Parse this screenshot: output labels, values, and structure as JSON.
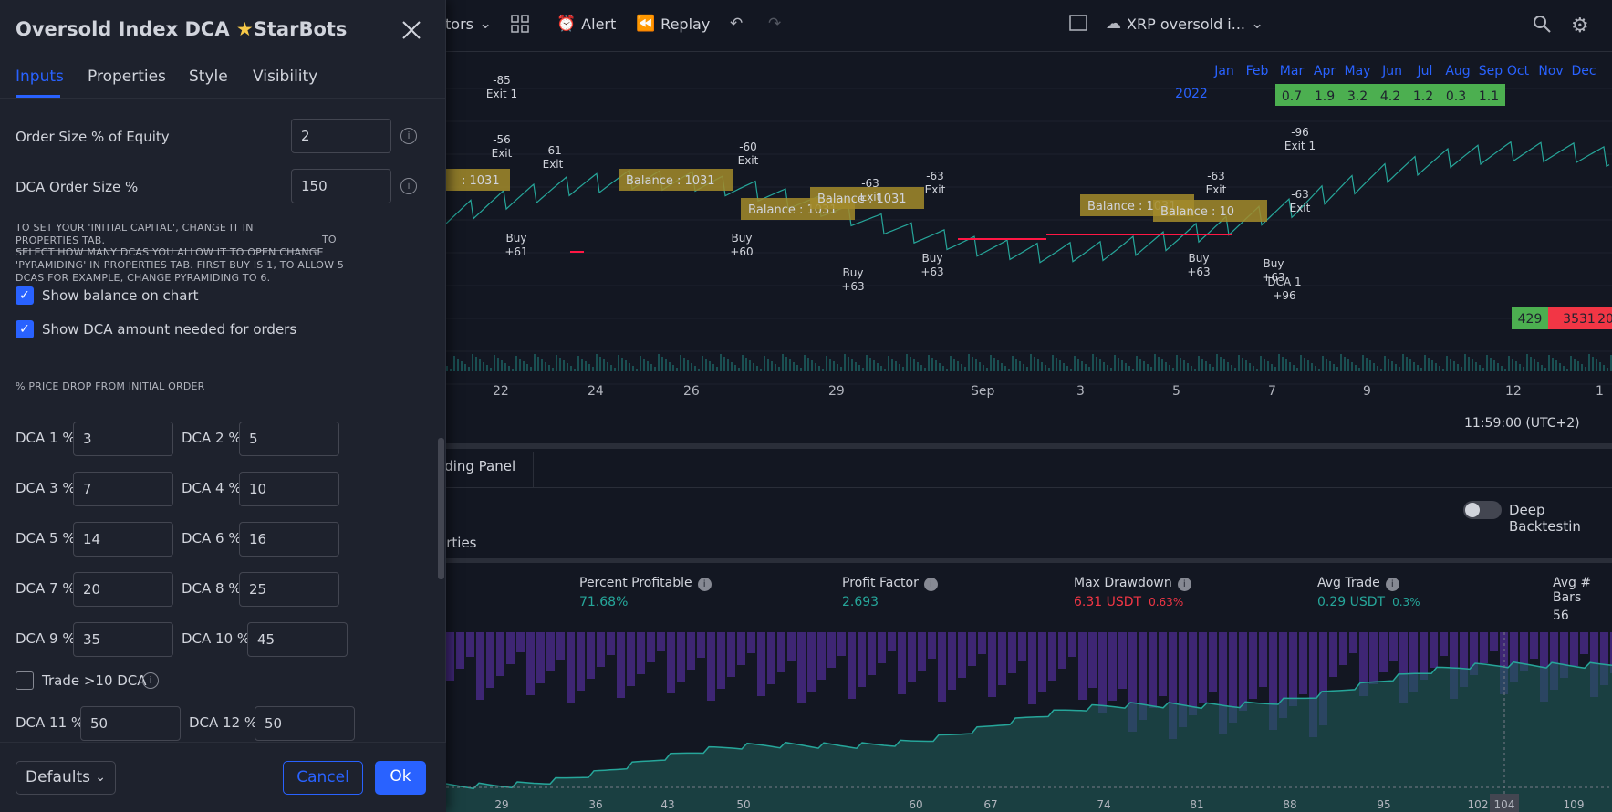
{
  "toolbar": {
    "indicators_partial": "tors",
    "alert": "Alert",
    "replay": "Replay",
    "layout_name": "XRP oversold i..."
  },
  "chart": {
    "x_ticks": [
      "22",
      "24",
      "26",
      "29",
      "Sep",
      "3",
      "5",
      "7",
      "9",
      "12",
      "1"
    ],
    "timestamp": "11:59:00 (UTC+2)",
    "trading_panel": "ading Panel",
    "properties_partial": "erties",
    "deep_backtesting": "Deep Backtestin",
    "months": [
      "Jan",
      "Feb",
      "Mar",
      "Apr",
      "May",
      "Jun",
      "Jul",
      "Aug",
      "Sep",
      "Oct",
      "Nov",
      "Dec"
    ],
    "year": "2022",
    "monthly_returns": [
      "0.7",
      "1.9",
      "3.2",
      "4.2",
      "1.2",
      "0.3",
      "1.1"
    ],
    "summary": [
      "429",
      "3531",
      "20"
    ],
    "labels": [
      {
        "text": "-85\nExit 1"
      },
      {
        "text": "-56\nExit"
      },
      {
        "text": "-61\nExit"
      },
      {
        "text": "-60\nExit"
      },
      {
        "text": "-63\nExit"
      },
      {
        "text": "-63\nExit"
      },
      {
        "text": "-63\nExit"
      },
      {
        "text": "-96\nExit 1"
      },
      {
        "text": "-63\nExit"
      },
      {
        "text": "Buy\n+61"
      },
      {
        "text": "Buy\n+60"
      },
      {
        "text": "Buy\n+63"
      },
      {
        "text": "Buy\n+63"
      },
      {
        "text": "Buy\n+63"
      },
      {
        "text": "Buy\n+63"
      },
      {
        "text": "DCA 1\n+96"
      }
    ],
    "balances": [
      "Balance  : 1031",
      "Balance  : 1031",
      "Balance  : 1031",
      "Balance  : 1031",
      "Balance  : 10",
      "Balance  : 1031"
    ],
    "bal_left": ": 1031"
  },
  "stats": [
    {
      "label": "Percent Profitable",
      "value": "71.68%",
      "sub": "",
      "color": "#26a69a"
    },
    {
      "label": "Profit Factor",
      "value": "2.693",
      "sub": "",
      "color": "#26a69a"
    },
    {
      "label": "Max Drawdown",
      "value": "6.31 USDT",
      "sub": "0.63%",
      "color": "#f23645"
    },
    {
      "label": "Avg Trade",
      "value": "0.29 USDT",
      "sub": "0.3%",
      "color": "#26a69a"
    },
    {
      "label": "Avg # Bars",
      "value": "56",
      "sub": "",
      "color": "#d1d4dc"
    }
  ],
  "equity_x_ticks": [
    "29",
    "36",
    "43",
    "50",
    "60",
    "67",
    "74",
    "81",
    "88",
    "95",
    "102",
    "104",
    "109"
  ],
  "dialog": {
    "title": "Oversold Index DCA",
    "brand": "StarBots",
    "tabs": [
      "Inputs",
      "Properties",
      "Style",
      "Visibility"
    ],
    "order_size_label": "Order Size % of Equity",
    "order_size_value": "2",
    "dca_order_label": "DCA Order Size %",
    "dca_order_value": "150",
    "note1": "TO SET YOUR 'INITIAL CAPITAL', CHANGE IT IN PROPERTIES TAB.",
    "note2a": "SELECT HOW MANY DCAS YOU ALLOW IT TO OPEN CHANGE",
    "note2b": "'PYRAMIDING' IN PROPERTIES TAB. FIRST BUY IS 1, TO ALLOW 5",
    "note2c": "DCAS FOR EXAMPLE, CHANGE PYRAMIDING TO 6.",
    "note2_to": "TO",
    "show_balance": "Show balance on chart",
    "show_dca": "Show DCA amount needed for orders",
    "price_drop": "% PRICE DROP FROM INITIAL ORDER",
    "dca": [
      {
        "label": "DCA 1 %",
        "value": "3"
      },
      {
        "label": "DCA 2 %",
        "value": "5"
      },
      {
        "label": "DCA 3 %",
        "value": "7"
      },
      {
        "label": "DCA 4 %",
        "value": "10"
      },
      {
        "label": "DCA 5 %",
        "value": "14"
      },
      {
        "label": "DCA 6 %",
        "value": "16"
      },
      {
        "label": "DCA 7 %",
        "value": "20"
      },
      {
        "label": "DCA 8 %",
        "value": "25"
      },
      {
        "label": "DCA 9 %",
        "value": "35"
      },
      {
        "label": "DCA 10 %",
        "value": "45"
      },
      {
        "label": "DCA 11 %",
        "value": "50"
      },
      {
        "label": "DCA 12 %",
        "value": "50"
      }
    ],
    "trade_more": "Trade >10 DCA",
    "defaults": "Defaults",
    "cancel": "Cancel",
    "ok": "Ok"
  }
}
